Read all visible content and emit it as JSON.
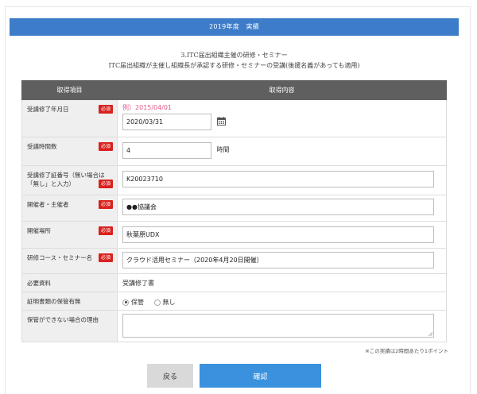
{
  "banner": {
    "title": "2019年度　実績"
  },
  "heading": {
    "line1": "3.ITC届出組織主催の研修・セミナー",
    "line2": "ITC届出組織が主催し組織長が承認する研修・セミナーの受講(後援名義があっても適用)"
  },
  "table": {
    "header": {
      "col1": "取得項目",
      "col2": "取得内容"
    },
    "required_badge": "必須",
    "rows": {
      "completion_date": {
        "label": "受講修了年月日",
        "example": "例）2015/04/01",
        "value": "2020/03/31"
      },
      "hours": {
        "label": "受講時間数",
        "value": "4",
        "unit": "時間"
      },
      "certificate": {
        "label_line1": "受講修了証番号（無い場合は",
        "label_line2": "「無し」と入力）",
        "value": "K20023710"
      },
      "organizer": {
        "label": "開催者・主催者",
        "value": "●●協議会"
      },
      "venue": {
        "label": "開催場所",
        "value": "秋葉原UDX"
      },
      "course": {
        "label": "研修コース・セミナー名",
        "value": "クラウド活用セミナー（2020年4月20日開催）"
      },
      "documents": {
        "label": "必要資料",
        "value": "受講修了書"
      },
      "proof_kept": {
        "label": "証明書類の保管有無",
        "option_yes": "保管",
        "option_no": "無し",
        "selected": "保管"
      },
      "reason": {
        "label": "保管ができない場合の理由",
        "value": ""
      }
    }
  },
  "note": "※この実績は2時間あたり1ポイント",
  "buttons": {
    "back": "戻る",
    "confirm": "確認"
  },
  "colors": {
    "banner": "#3d7cc9",
    "header": "#5f5f5f",
    "required": "#d9211d",
    "example": "#e35a8c",
    "confirm": "#3a91de",
    "back": "#d9d9d9"
  }
}
